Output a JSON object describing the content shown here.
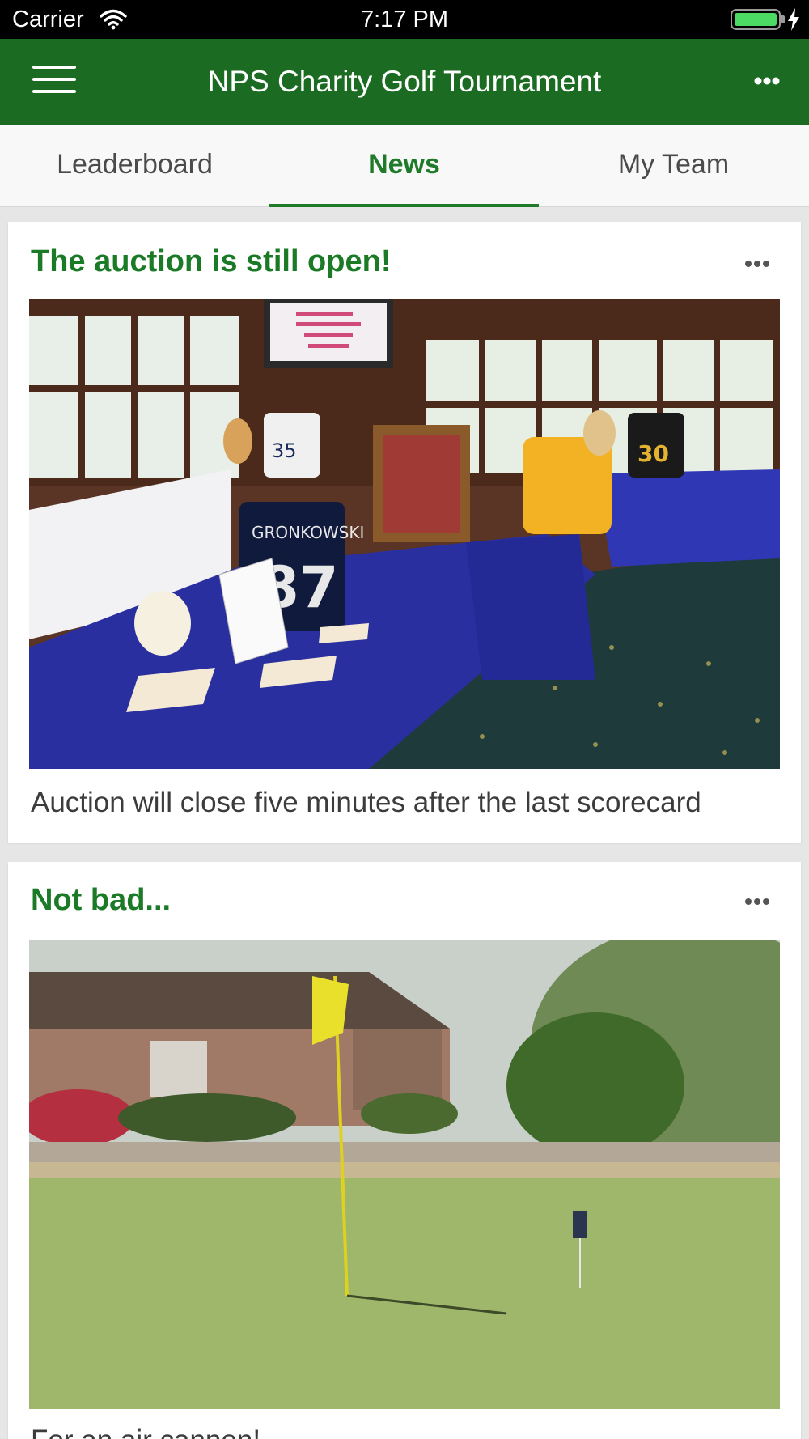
{
  "status_bar": {
    "carrier": "Carrier",
    "time": "7:17 PM",
    "icons": [
      "wifi-icon",
      "battery-icon",
      "charging-bolt-icon"
    ],
    "battery_level": 1.0
  },
  "nav": {
    "title": "NPS Charity Golf Tournament",
    "left_icon": "hamburger-menu-icon",
    "right_icon": "more-horizontal-icon"
  },
  "tabs": [
    {
      "label": "Leaderboard",
      "active": false
    },
    {
      "label": "News",
      "active": true
    },
    {
      "label": "My Team",
      "active": false
    }
  ],
  "posts": [
    {
      "title": "The auction is still open!",
      "caption": "Auction will close five minutes after the last scorecard",
      "image": "auction-photo"
    },
    {
      "title": "Not bad...",
      "caption": "For an air cannon!",
      "image": "golf-green-photo"
    }
  ],
  "colors": {
    "brand_green": "#1b6b22",
    "accent_green": "#1f7a2a",
    "background": "#e6e6e6"
  }
}
